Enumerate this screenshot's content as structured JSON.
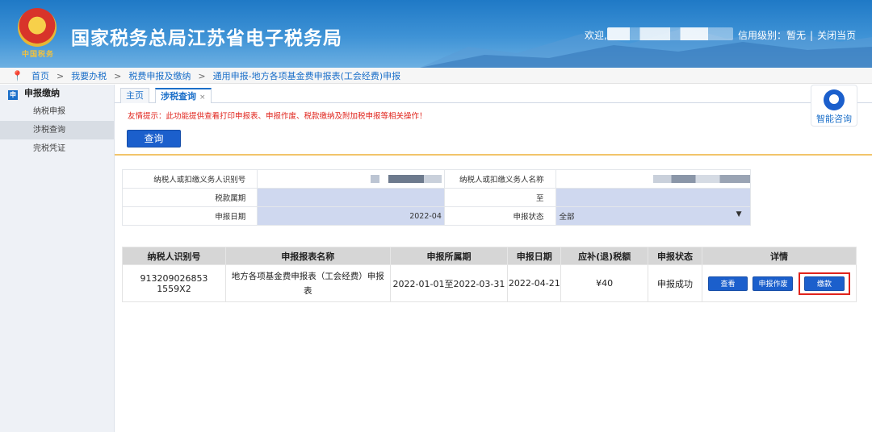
{
  "header": {
    "title": "国家税务总局江苏省电子税务局",
    "emblem_subtext": "中国税务",
    "welcome": "欢迎,",
    "credit": "信用级别：暂无",
    "close": "关闭当页"
  },
  "breadcrumb": {
    "items": [
      "首页",
      "我要办税",
      "税费申报及缴纳",
      "通用申报-地方各项基金费申报表(工会经费)申报"
    ]
  },
  "sidebar": {
    "heading": "申报缴纳",
    "items": [
      "纳税申报",
      "涉税查询",
      "完税凭证"
    ],
    "active_index": 1
  },
  "tabs": {
    "home": "主页",
    "active": "涉税查询"
  },
  "tip": "友情提示：此功能提供查看打印申报表、申报作废、税款缴纳及附加税申报等相关操作！",
  "query_button": "查询",
  "assistant": {
    "label": "智能咨询"
  },
  "form": {
    "taxpayer_id_label": "纳税人或扣缴义务人识别号",
    "taxpayer_name_label": "纳税人或扣缴义务人名称",
    "period_label": "税款属期",
    "to_label": "至",
    "date_label": "申报日期",
    "date_value": "2022-04",
    "status_label": "申报状态",
    "status_value": "全部"
  },
  "results": {
    "headers": [
      "纳税人识别号",
      "申报报表名称",
      "申报所属期",
      "申报日期",
      "应补(退)税额",
      "申报状态",
      "详情"
    ],
    "rows": [
      {
        "taxpayer_id": "913209026853 1559X2",
        "report_name": "地方各项基金费申报表（工会经费）申报表",
        "period": "2022-01-01至2022-03-31",
        "date": "2022-04-21",
        "amount": "¥40",
        "status": "申报成功",
        "actions": {
          "view": "查看",
          "void": "申报作废",
          "pay": "缴款"
        }
      }
    ]
  },
  "colors": {
    "primary": "#1b5fcc",
    "tip_red": "#e0231b",
    "highlight_red": "#e0231b"
  }
}
